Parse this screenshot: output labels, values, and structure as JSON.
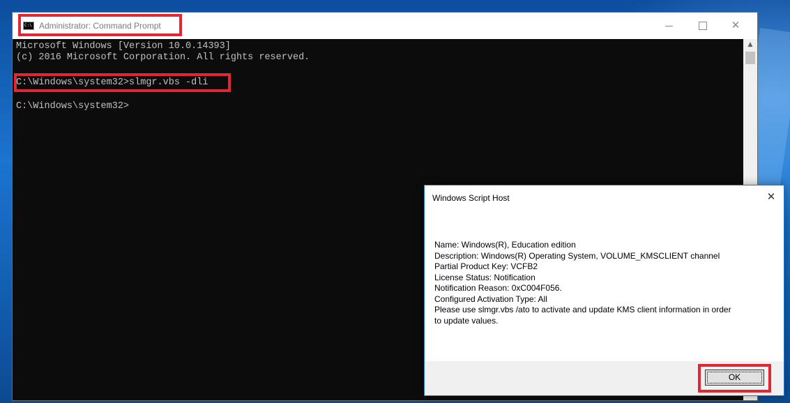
{
  "cmd": {
    "icon_text": "C:\\",
    "title": "Administrator: Command Prompt",
    "controls": {
      "minimize": "minimize-icon",
      "maximize": "maximize-icon",
      "close": "close-icon",
      "close_glyph": "✕"
    },
    "lines": [
      "Microsoft Windows [Version 10.0.14393]",
      "(c) 2016 Microsoft Corporation. All rights reserved.",
      "",
      "C:\\Windows\\system32>slmgr.vbs -dli",
      "",
      "C:\\Windows\\system32>"
    ],
    "scroll_up_glyph": "▲"
  },
  "dialog": {
    "title": "Windows Script Host",
    "close_glyph": "✕",
    "lines": [
      "Name: Windows(R), Education edition",
      "Description: Windows(R) Operating System, VOLUME_KMSCLIENT channel",
      "Partial Product Key: VCFB2",
      "License Status: Notification",
      "Notification Reason: 0xC004F056.",
      "Configured Activation Type: All",
      "Please use slmgr.vbs /ato to activate and update KMS client information in order",
      "to update values."
    ],
    "ok_label": "OK"
  },
  "colors": {
    "highlight": "#e32634",
    "console_bg": "#0c0c0c",
    "console_text": "#c0c0c0",
    "desktop": "#1a6fc4"
  }
}
